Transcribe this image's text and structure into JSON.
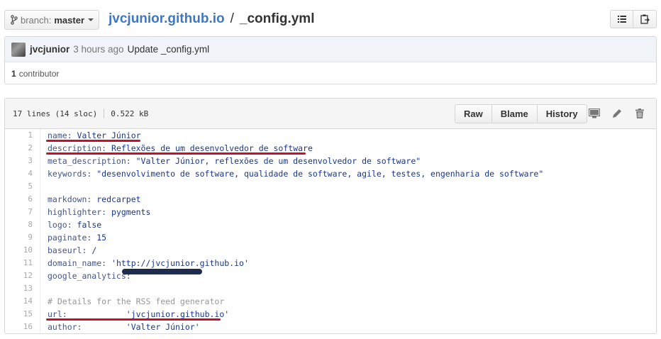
{
  "header": {
    "branch_prefix": "branch:",
    "branch_name": "master",
    "repo": "jvcjunior.github.io",
    "separator": "/",
    "file": "_config.yml"
  },
  "commit": {
    "author": "jvcjunior",
    "time": "3 hours ago",
    "message": "Update _config.yml",
    "contributors_count": "1",
    "contributors_label": "contributor"
  },
  "file_info": {
    "lines": "17 lines (14 sloc)",
    "size": "0.522 kB"
  },
  "actions": {
    "raw": "Raw",
    "blame": "Blame",
    "history": "History"
  },
  "icons": {
    "list": "list-icon",
    "clipboard": "clipboard-icon",
    "desktop": "desktop-icon",
    "pencil": "pencil-icon",
    "trash": "trash-icon",
    "branch": "branch-icon"
  },
  "colors": {
    "link": "#4078c0",
    "annotation": "#c8102e",
    "key": "#445588",
    "string": "#183691",
    "comment": "#969896"
  },
  "code_lines": [
    {
      "n": "1",
      "key": "name:",
      "val": " Valter Júnior"
    },
    {
      "n": "2",
      "key": "description:",
      "val": " Reflexões de um desenvolvedor de software"
    },
    {
      "n": "3",
      "key": "meta_description:",
      "val": " \"Valter Júnior, reflexões de um desenvolvedor de software\""
    },
    {
      "n": "4",
      "key": "keywords:",
      "val": " \"desenvolvimento de software, qualidade de software, agile, testes, engenharia de software\""
    },
    {
      "n": "5",
      "key": "",
      "val": ""
    },
    {
      "n": "6",
      "key": "markdown:",
      "val": " redcarpet"
    },
    {
      "n": "7",
      "key": "highlighter:",
      "val": " pygments"
    },
    {
      "n": "8",
      "key": "logo:",
      "val": " false"
    },
    {
      "n": "9",
      "key": "paginate:",
      "val": " 15"
    },
    {
      "n": "10",
      "key": "baseurl:",
      "val": " /"
    },
    {
      "n": "11",
      "key": "domain_name:",
      "val": " 'http://jvcjunior.github.io'"
    },
    {
      "n": "12",
      "key": "google_analytics:",
      "val": ""
    },
    {
      "n": "13",
      "key": "",
      "val": ""
    },
    {
      "n": "14",
      "comment": "# Details for the RSS feed generator"
    },
    {
      "n": "15",
      "key": "url:",
      "val": "            'jvcjunior.github.io'"
    },
    {
      "n": "16",
      "key": "author:",
      "val": "         'Valter Júnior'"
    }
  ]
}
